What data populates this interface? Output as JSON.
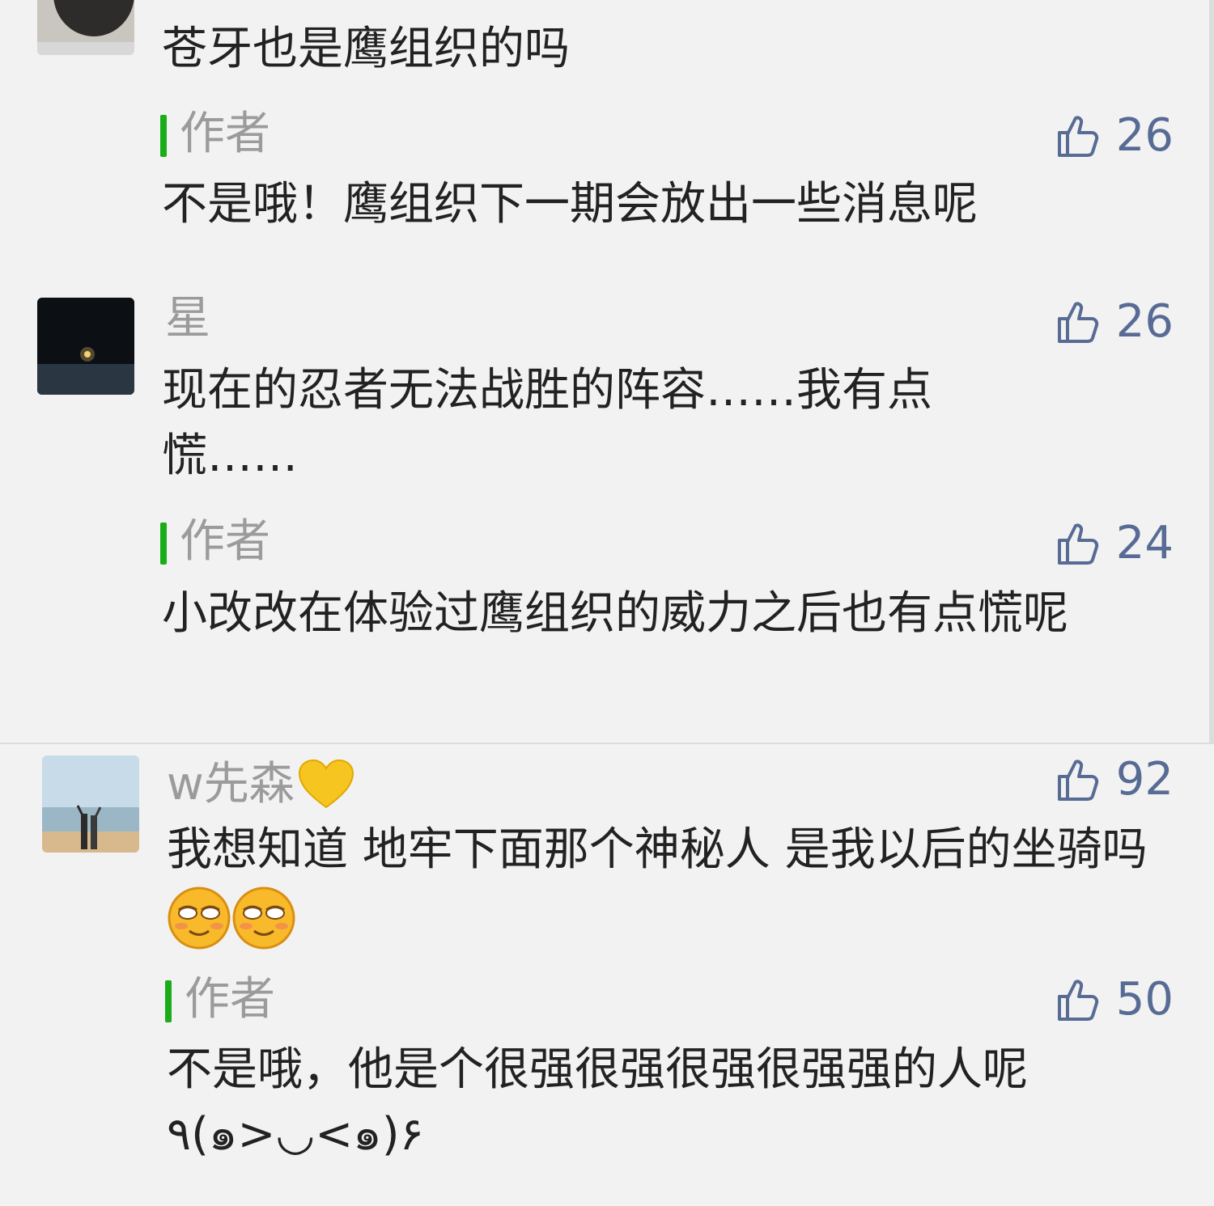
{
  "comments": [
    {
      "text": "苍牙也是鹰组织的吗",
      "reply": {
        "label": "作者",
        "likes": "26",
        "text": "不是哦！鹰组织下一期会放出一些消息呢"
      }
    },
    {
      "username": "星",
      "likes": "26",
      "text": "现在的忍者无法战胜的阵容……我有点慌……",
      "reply": {
        "label": "作者",
        "likes": "24",
        "text": "小改改在体验过鹰组织的威力之后也有点慌呢"
      }
    },
    {
      "username": "w先森",
      "likes": "92",
      "text": "我想知道 地牢下面那个神秘人 是我以后的坐骑吗",
      "reply": {
        "label": "作者",
        "likes": "50",
        "text": "不是哦，他是个很强很强很强很强强的人呢",
        "text2": "٩(๑>◡<๑)۶"
      }
    }
  ],
  "icons": {
    "like": "thumbs-up-icon",
    "emoji": "smirk-emoji",
    "heart": "yellow-heart-icon"
  },
  "colors": {
    "accent": "#576b95",
    "author_bar": "#1aad19"
  }
}
